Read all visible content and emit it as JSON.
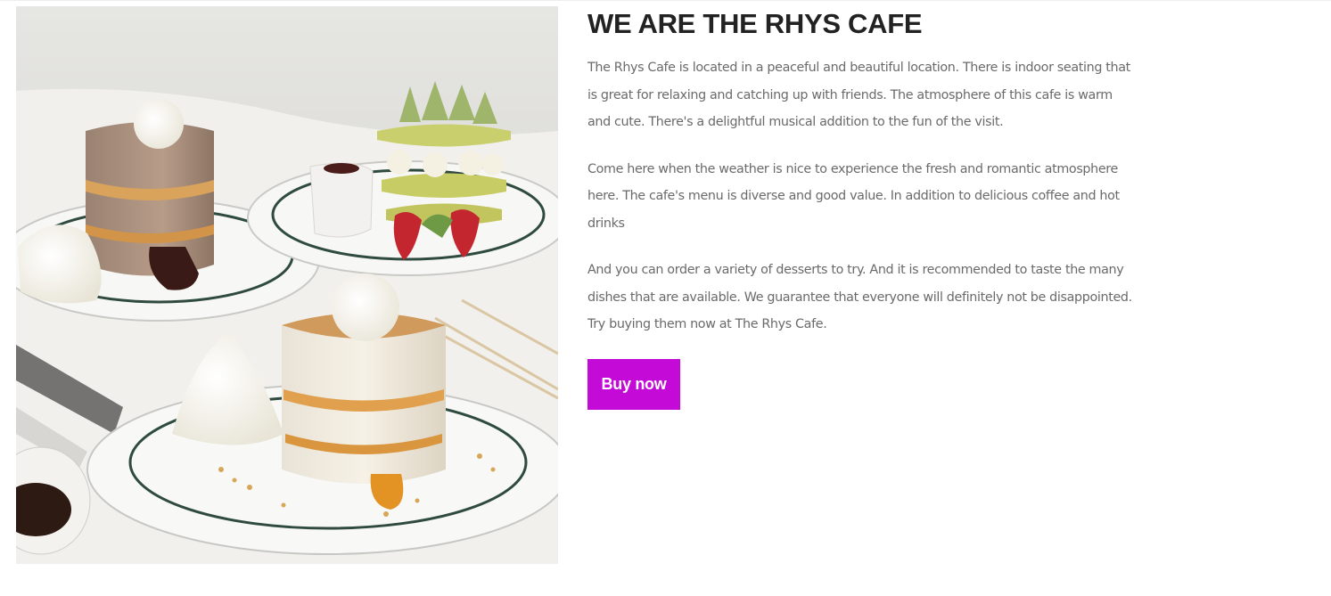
{
  "about": {
    "image_alt": "Souffle pancakes with ice cream, whipped cream and strawberries",
    "title": "WE ARE THE RHYS CAFE",
    "paragraphs": [
      "The Rhys Cafe is located in a peaceful and beautiful location. There is indoor seating that is great for relaxing and catching up with friends. The atmosphere of this cafe is warm and cute. There's a delightful musical addition to the fun of the visit.",
      "Come here when the weather is nice to experience the fresh and romantic atmosphere here. The cafe's menu is diverse and good value. In addition to delicious coffee and hot drinks",
      "And you can order a variety of desserts to try. And it is recommended to taste the many dishes that are available. We guarantee that everyone will definitely not be disappointed. Try buying them now at The Rhys Cafe."
    ],
    "buy_button_label": "Buy now"
  },
  "colors": {
    "accent": "#c40ad6",
    "heading": "#222222",
    "body_text": "#6a6a6a",
    "background": "#ffffff"
  }
}
